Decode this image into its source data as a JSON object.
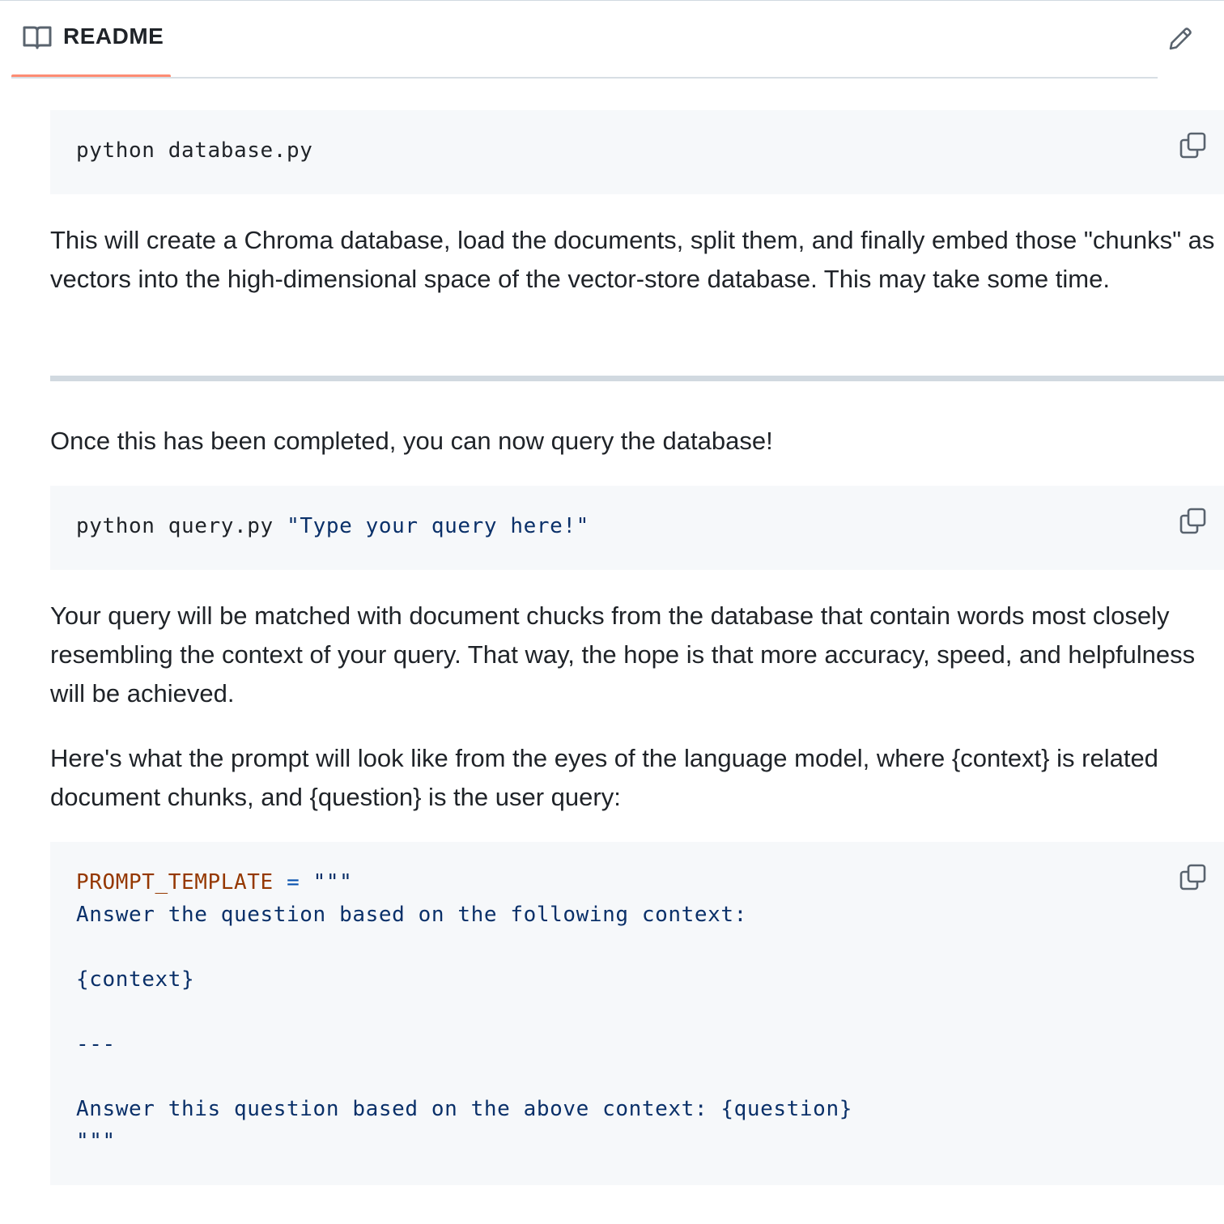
{
  "header": {
    "tab_label": "README",
    "tab_icon": "book-icon",
    "edit_icon": "pencil-icon",
    "accent_color": "#fd8c73"
  },
  "blocks": {
    "code1": {
      "text": "python database.py",
      "copy_icon": "copy-icon"
    },
    "para1": "This will create a Chroma database, load the documents, split them, and finally embed those \"chunks\" as vectors into the high-dimensional space of the vector-store database. This may take some time.",
    "para2": "Once this has been completed, you can now query the database!",
    "code2": {
      "command": "python query.py ",
      "argument": "\"Type your query here!\"",
      "copy_icon": "copy-icon"
    },
    "para3": "Your query will be matched with document chucks from the database that contain words most closely resembling the context of your query. That way, the hope is that more accuracy, speed, and helpfulness will be achieved.",
    "para4": "Here's what the prompt will look like from the eyes of the language model, where {context} is related document chunks, and {question} is the user query:",
    "code3": {
      "var_name": "PROMPT_TEMPLATE",
      "operator": " = ",
      "open_quote": "\"\"\"",
      "line2": "Answer the question based on the following context:",
      "line4": "{context}",
      "line6": "---",
      "line8": "Answer this question based on the above context: {question}",
      "close_quote": "\"\"\"",
      "copy_icon": "copy-icon"
    }
  }
}
